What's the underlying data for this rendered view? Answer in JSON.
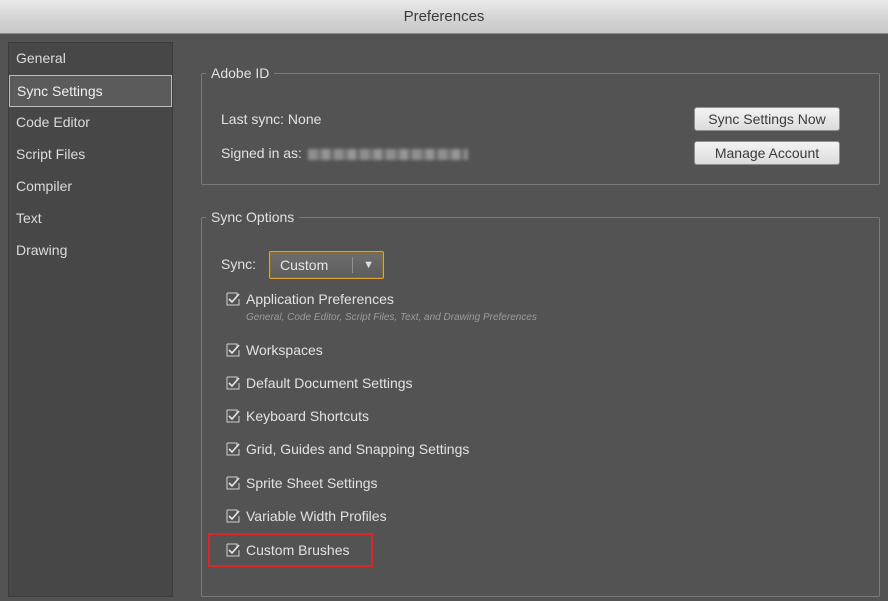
{
  "window": {
    "title": "Preferences"
  },
  "sidebar": {
    "items": [
      {
        "label": "General"
      },
      {
        "label": "Sync Settings",
        "selected": true
      },
      {
        "label": "Code Editor"
      },
      {
        "label": "Script Files"
      },
      {
        "label": "Compiler"
      },
      {
        "label": "Text"
      },
      {
        "label": "Drawing"
      }
    ]
  },
  "adobe_id": {
    "legend": "Adobe ID",
    "last_sync_label": "Last sync: None",
    "signed_in_label": "Signed in as:",
    "sync_now_button": "Sync Settings Now",
    "manage_account_button": "Manage Account"
  },
  "sync_options": {
    "legend": "Sync Options",
    "sync_label": "Sync:",
    "sync_value": "Custom",
    "app_prefs_subtext": "General, Code Editor, Script Files, Text, and Drawing Preferences",
    "options": [
      {
        "label": "Application Preferences",
        "checked": true
      },
      {
        "label": "Workspaces",
        "checked": true
      },
      {
        "label": "Default Document Settings",
        "checked": true
      },
      {
        "label": "Keyboard Shortcuts",
        "checked": true
      },
      {
        "label": "Grid, Guides and Snapping Settings",
        "checked": true
      },
      {
        "label": "Sprite Sheet Settings",
        "checked": true
      },
      {
        "label": "Variable Width Profiles",
        "checked": true
      },
      {
        "label": "Custom Brushes",
        "checked": true,
        "highlighted": true
      }
    ]
  },
  "colors": {
    "highlight": "#d8262b",
    "select_focus": "#e0a531",
    "panel_bg": "#535353"
  }
}
